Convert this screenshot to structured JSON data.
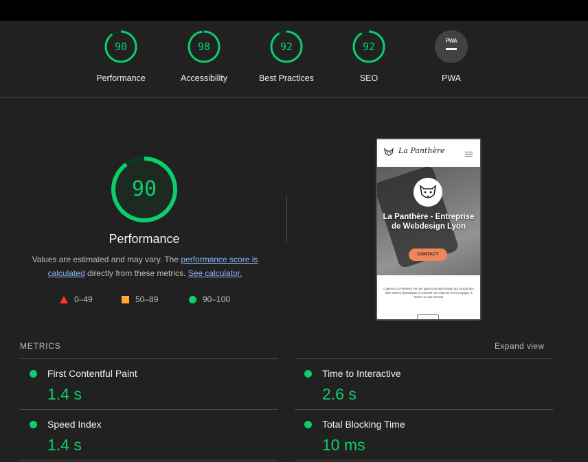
{
  "categories": [
    {
      "score": "90",
      "label": "Performance",
      "fraction": 0.9
    },
    {
      "score": "98",
      "label": "Accessibility",
      "fraction": 0.98
    },
    {
      "score": "92",
      "label": "Best Practices",
      "fraction": 0.92
    },
    {
      "score": "92",
      "label": "SEO",
      "fraction": 0.92
    },
    {
      "badge_text": "PWA",
      "label": "PWA"
    }
  ],
  "performance": {
    "score": "90",
    "fraction": 0.9,
    "title": "Performance",
    "desc_prefix": "Values are estimated and may vary. The ",
    "link_score": "performance score is calculated",
    "desc_mid": " directly from these metrics. ",
    "link_calc": "See calculator."
  },
  "legend": [
    {
      "range": "0–49",
      "color": "#ff3333"
    },
    {
      "range": "50–89",
      "color": "#ffaa33"
    },
    {
      "range": "90–100",
      "color": "#0cce6b"
    }
  ],
  "screenshot": {
    "brand": "La Panthère",
    "hero_title": "La Panthère - Entreprise de Webdesign Lyon",
    "button": "CONTACT",
    "body_text": "L'agence La Panthère est une agence de web design qui conçoit des sites vitrines dynamiques à convertir vos visiteurs et les engager, à travers un site internet"
  },
  "metrics": {
    "header": "METRICS",
    "expand": "Expand view",
    "items": [
      {
        "name": "First Contentful Paint",
        "value": "1.4 s"
      },
      {
        "name": "Time to Interactive",
        "value": "2.6 s"
      },
      {
        "name": "Speed Index",
        "value": "1.4 s"
      },
      {
        "name": "Total Blocking Time",
        "value": "10 ms"
      }
    ]
  },
  "colors": {
    "pass": "#0cce6b",
    "average": "#ffaa33",
    "fail": "#ff3333",
    "background": "#212121",
    "link": "#8ab4f8"
  }
}
